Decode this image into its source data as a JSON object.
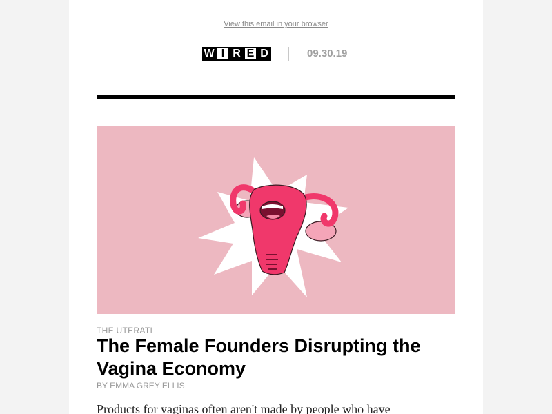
{
  "header": {
    "browser_link": "View this email in your browser",
    "logo_letters": [
      "W",
      "I",
      "R",
      "E",
      "D"
    ],
    "date": "09.30.19"
  },
  "story": {
    "kicker": "THE UTERATI",
    "headline": "The Female Founders Disrupting the Vagina Economy",
    "byline": "BY EMMA GREY ELLIS",
    "dek": "Products for vaginas often aren't made by people who have"
  },
  "colors": {
    "page_bg": "#f3f3f3",
    "hero_bg": "#edb8c1",
    "illustration_pink": "#f0386b",
    "meta_gray": "#9a9a9a"
  }
}
